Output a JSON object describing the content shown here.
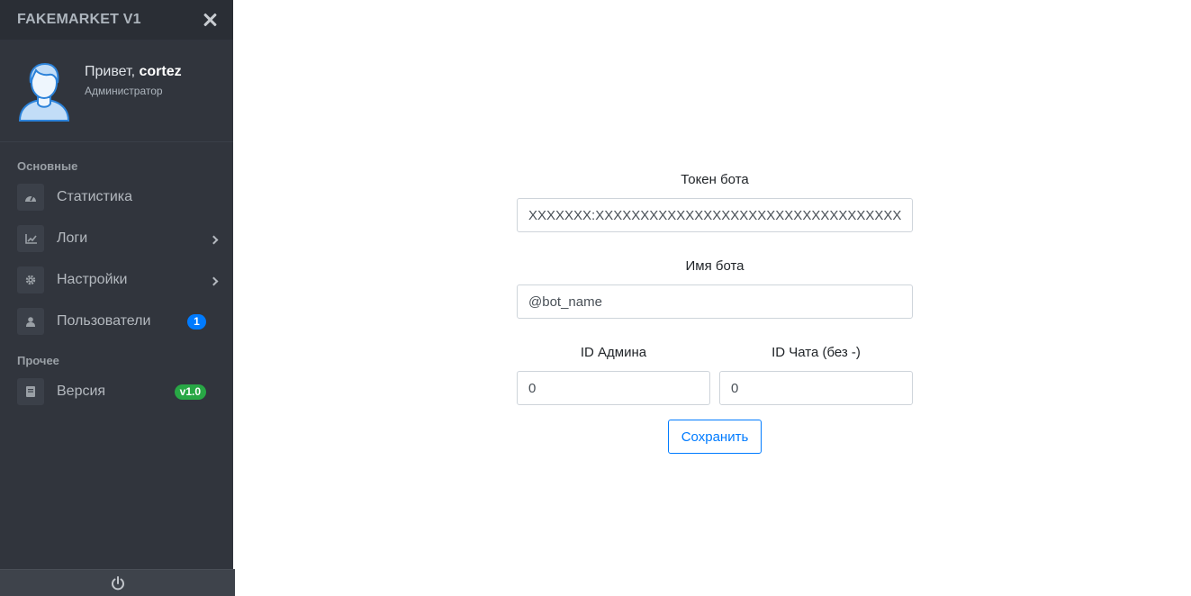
{
  "brand": {
    "title": "FAKEMARKET V1"
  },
  "user": {
    "greeting_prefix": "Привет, ",
    "username": "cortez",
    "role": "Администратор"
  },
  "sidebar": {
    "section_main": "Основные",
    "section_other": "Прочее",
    "items": [
      {
        "label": "Статистика",
        "icon": "dashboard-icon"
      },
      {
        "label": "Логи",
        "icon": "chart-icon",
        "has_submenu": true
      },
      {
        "label": "Настройки",
        "icon": "gear-icon",
        "has_submenu": true
      },
      {
        "label": "Пользователи",
        "icon": "user-icon",
        "badge": "1"
      },
      {
        "label": "Версия",
        "icon": "book-icon",
        "badge": "v1.0"
      }
    ],
    "footer_icon": "power-icon"
  },
  "form": {
    "token_label": "Токен бота",
    "token_value": "XXXXXXX:XXXXXXXXXXXXXXXXXXXXXXXXXXXXXXXXXXX",
    "name_label": "Имя бота",
    "name_value": "@bot_name",
    "admin_id_label": "ID Админа",
    "admin_id_value": "0",
    "chat_id_label": "ID Чата (без -)",
    "chat_id_value": "0",
    "save_label": "Сохранить"
  },
  "colors": {
    "sidebar_bg": "#31353d",
    "accent": "#007bff",
    "badge_green": "#28a745"
  }
}
